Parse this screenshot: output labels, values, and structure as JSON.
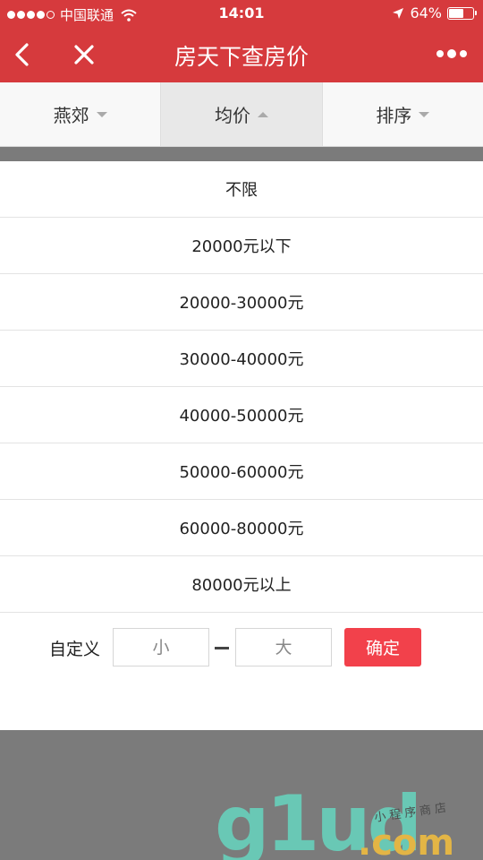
{
  "status_bar": {
    "carrier": "中国联通",
    "time": "14:01",
    "battery": "64%",
    "battery_level": 0.64
  },
  "nav": {
    "title": "房天下查房价"
  },
  "filters": [
    {
      "label": "燕郊",
      "active": false
    },
    {
      "label": "均价",
      "active": true
    },
    {
      "label": "排序",
      "active": false
    }
  ],
  "price_options": [
    "不限",
    "20000元以下",
    "20000-30000元",
    "30000-40000元",
    "40000-50000元",
    "50000-60000元",
    "60000-80000元",
    "80000元以上"
  ],
  "custom": {
    "label": "自定义",
    "min_placeholder": "小",
    "max_placeholder": "大",
    "confirm_label": "确定"
  },
  "watermark": {
    "main": "g1ud",
    "suffix": ".com",
    "small": "小程序商店"
  },
  "colors": {
    "header": "#d63a3d",
    "confirm": "#f2414b",
    "overlay": "#7b7b7b"
  }
}
